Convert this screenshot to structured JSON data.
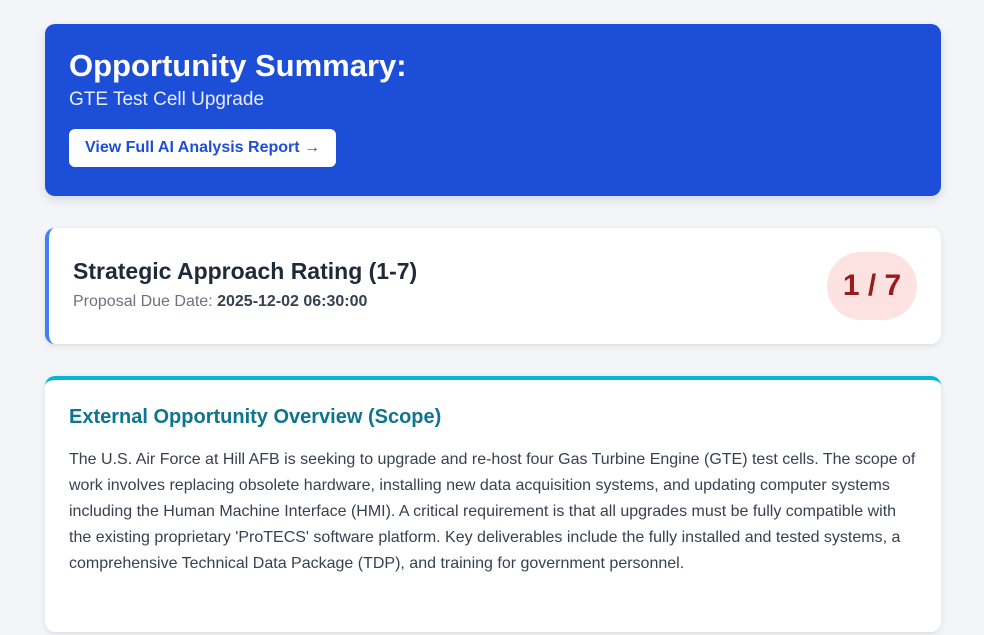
{
  "hero": {
    "title": "Opportunity Summary:",
    "subtitle": "GTE Test Cell Upgrade",
    "button": "View Full AI Analysis Report →"
  },
  "rating": {
    "title": "Strategic Approach Rating (1-7)",
    "due_label": "Proposal Due Date:",
    "due_value": "2025-12-02 06:30:00",
    "score": "1 / 7"
  },
  "scope": {
    "title": "External Opportunity Overview (Scope)",
    "body": "The U.S. Air Force at Hill AFB is seeking to upgrade and re-host four Gas Turbine Engine (GTE) test cells. The scope of work involves replacing obsolete hardware, installing new data acquisition systems, and updating computer systems including the Human Machine Interface (HMI). A critical requirement is that all upgrades must be fully compatible with the existing proprietary 'ProTECS' software platform. Key deliverables include the fully installed and tested systems, a comprehensive Technical Data Package (TDP), and training for government personnel."
  }
}
